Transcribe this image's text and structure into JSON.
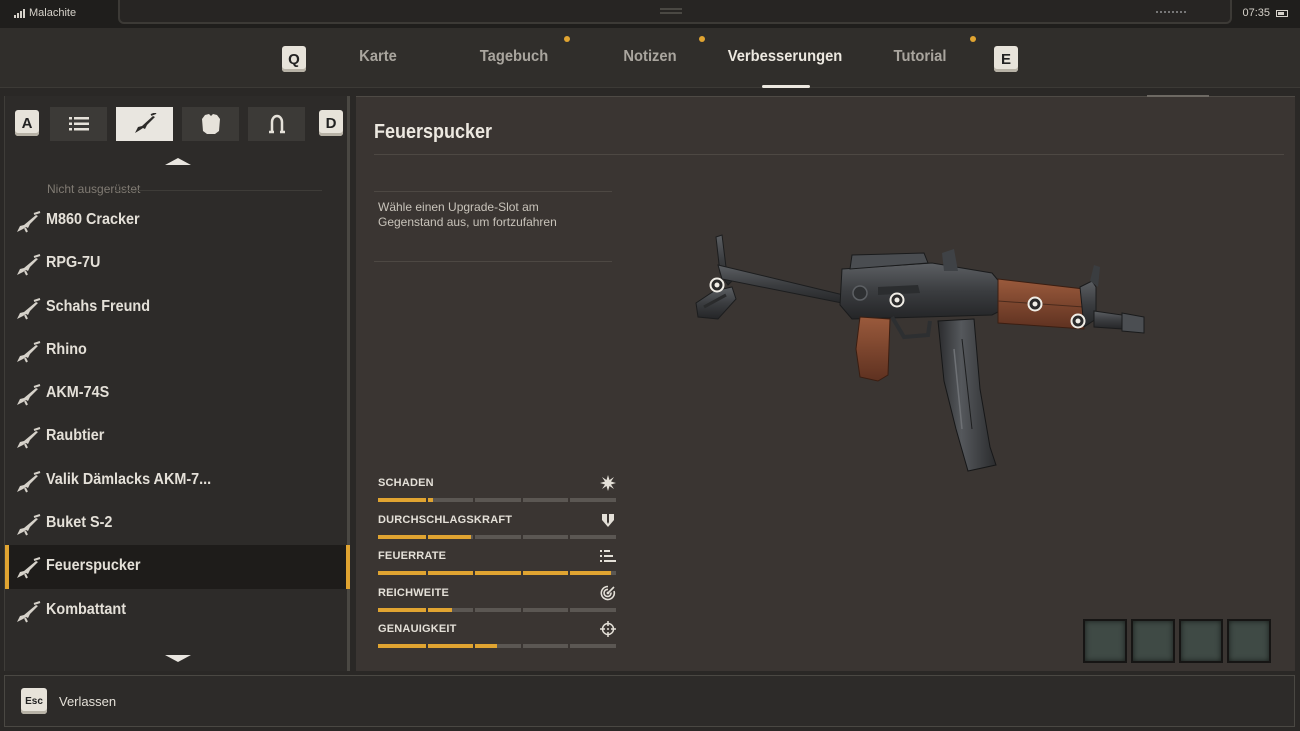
{
  "status": {
    "carrier": "Malachite",
    "time": "07:35"
  },
  "nav": {
    "prev_key": "Q",
    "next_key": "E",
    "tabs": [
      {
        "label": "Karte",
        "notification": false
      },
      {
        "label": "Tagebuch",
        "notification": true
      },
      {
        "label": "Notizen",
        "notification": true
      },
      {
        "label": "Verbesserungen",
        "notification": false,
        "active": true
      },
      {
        "label": "Tutorial",
        "notification": true
      }
    ],
    "accent": "#e0a431"
  },
  "filters": {
    "prev_key": "A",
    "next_key": "D",
    "items": [
      {
        "icon": "list-icon"
      },
      {
        "icon": "rifle-icon",
        "active": true
      },
      {
        "icon": "armor-icon"
      },
      {
        "icon": "artifact-icon"
      }
    ]
  },
  "inventory": {
    "section_label": "Nicht ausgerüstet",
    "weapons": [
      {
        "name": "M860 Cracker"
      },
      {
        "name": "RPG-7U"
      },
      {
        "name": "Schahs Freund"
      },
      {
        "name": "Rhino"
      },
      {
        "name": "AKM-74S"
      },
      {
        "name": "Raubtier"
      },
      {
        "name": "Valik Dämlacks AKM-7..."
      },
      {
        "name": "Buket S-2"
      },
      {
        "name": "Feuerspucker",
        "selected": true
      },
      {
        "name": "Kombattant"
      }
    ]
  },
  "detail": {
    "title": "Feuerspucker",
    "hint": "Wähle einen Upgrade-Slot am Gegenstand aus, um fortzufahren",
    "stats": [
      {
        "label": "SCHADEN",
        "icon": "explosion-icon",
        "value": 0.23
      },
      {
        "label": "DURCHSCHLAGSKRAFT",
        "icon": "penetration-icon",
        "value": 0.39
      },
      {
        "label": "FEUERRATE",
        "icon": "fire-rate-icon",
        "value": 0.98
      },
      {
        "label": "REICHWEITE",
        "icon": "range-icon",
        "value": 0.31
      },
      {
        "label": "GENAUIGKEIT",
        "icon": "accuracy-icon",
        "value": 0.5
      }
    ],
    "upgrade_slots": 4
  },
  "footer": {
    "key": "Esc",
    "label": "Verlassen"
  }
}
